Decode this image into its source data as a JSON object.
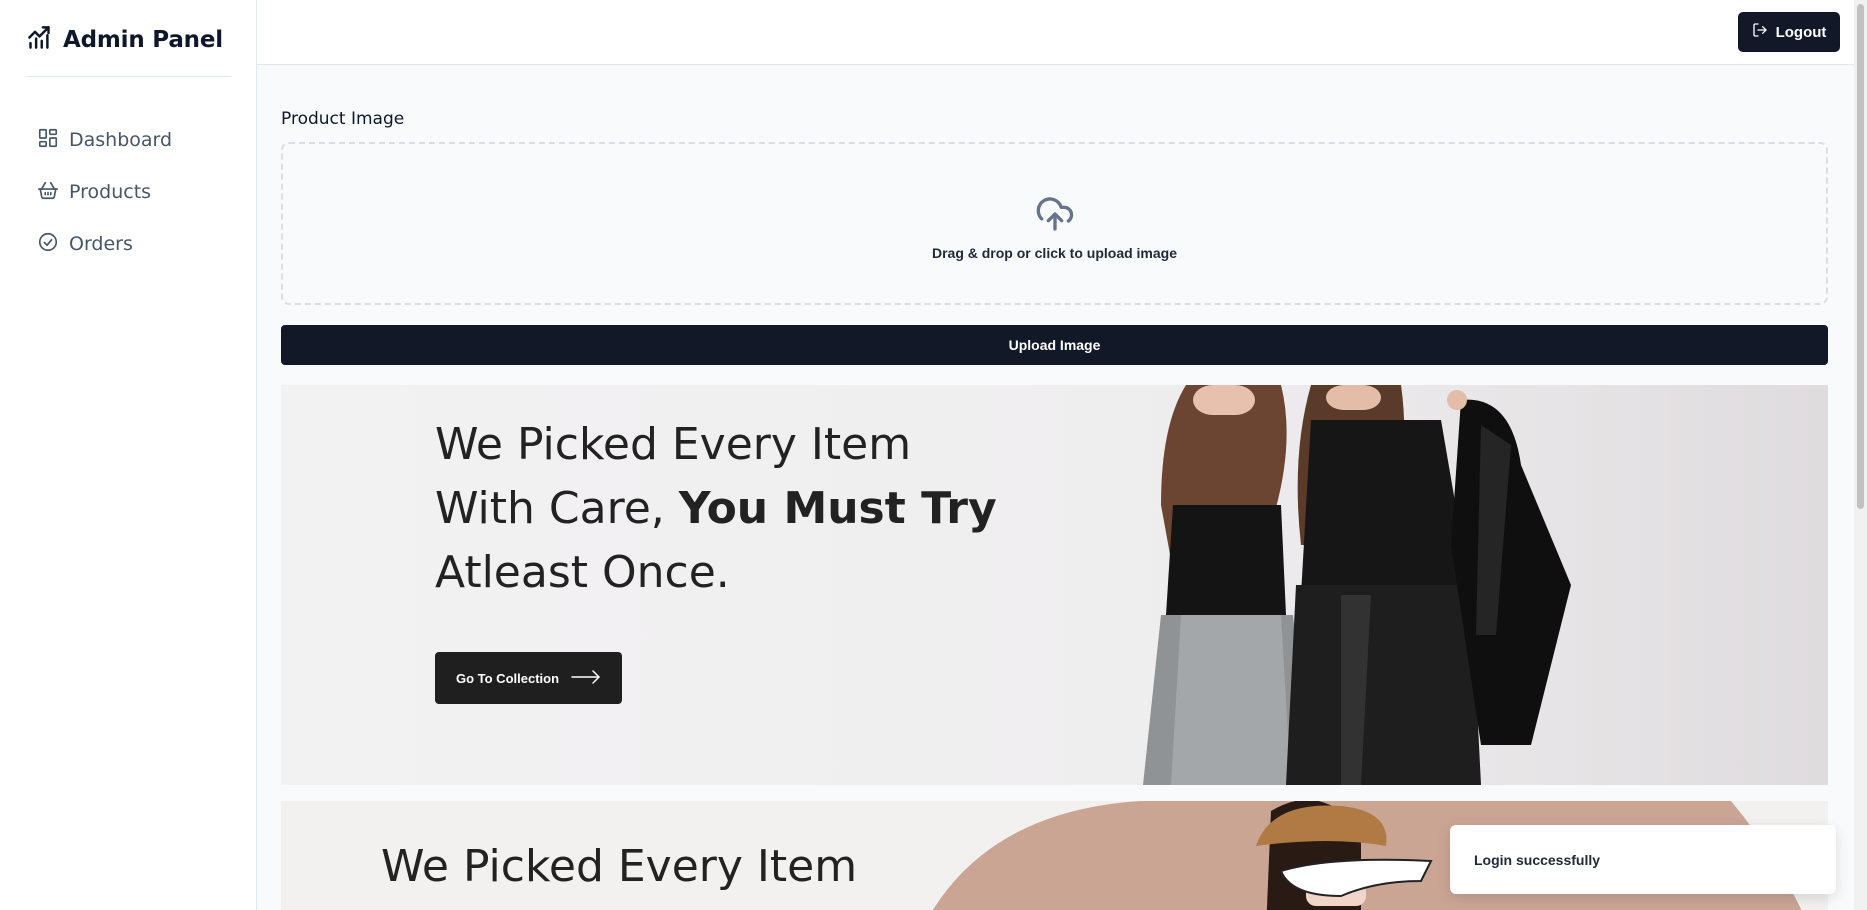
{
  "brand": {
    "title": "Admin Panel",
    "icon": "chart-line-icon"
  },
  "sidebar": {
    "items": [
      {
        "label": "Dashboard",
        "icon": "dashboard-grid-icon"
      },
      {
        "label": "Products",
        "icon": "basket-icon"
      },
      {
        "label": "Orders",
        "icon": "check-circle-icon"
      }
    ]
  },
  "header": {
    "logout_label": "Logout",
    "logout_icon": "logout-icon"
  },
  "form": {
    "image_label": "Product Image",
    "dropzone_text": "Drag & drop or click to upload image",
    "dropzone_icon": "cloud-upload-icon",
    "upload_button": "Upload Image"
  },
  "banner": {
    "line1": "We Picked Every Item",
    "line2_regular": "With Care, ",
    "line2_bold": "You Must Try",
    "line3": "Atleast Once.",
    "cta_label": "Go To Collection"
  },
  "banner2": {
    "line1": "We Picked Every Item"
  },
  "toast": {
    "message": "Login successfully"
  },
  "colors": {
    "primary": "#111827",
    "background": "#f8fafc",
    "border": "#e2e8f0",
    "muted_text": "#475569"
  }
}
